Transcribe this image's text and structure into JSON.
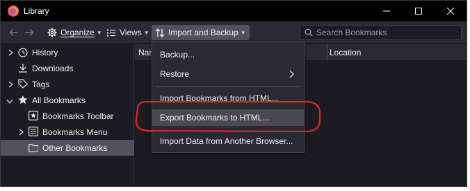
{
  "window": {
    "title": "Library"
  },
  "toolbar": {
    "organize_label": "Organize",
    "views_label": "Views",
    "import_label": "Import and Backup",
    "search_placeholder": "Search Bookmarks"
  },
  "sidebar": {
    "items": [
      {
        "label": "History",
        "icon": "clock-icon",
        "twisty": "collapsed"
      },
      {
        "label": "Downloads",
        "icon": "download-icon",
        "twisty": "none"
      },
      {
        "label": "Tags",
        "icon": "tag-icon",
        "twisty": "collapsed"
      },
      {
        "label": "All Bookmarks",
        "icon": "star-icon",
        "twisty": "expanded"
      },
      {
        "label": "Bookmarks Toolbar",
        "icon": "toolbar-folder-icon",
        "twisty": "none"
      },
      {
        "label": "Bookmarks Menu",
        "icon": "menu-folder-icon",
        "twisty": "collapsed"
      },
      {
        "label": "Other Bookmarks",
        "icon": "folder-icon",
        "twisty": "none",
        "selected": true
      }
    ]
  },
  "columns": {
    "name": "Nam",
    "location": "Location"
  },
  "menu": {
    "items": [
      {
        "label": "Backup...",
        "has_submenu": false
      },
      {
        "label": "Restore",
        "has_submenu": true
      },
      {
        "label": "Import Bookmarks from HTML...",
        "has_submenu": false
      },
      {
        "label": "Export Bookmarks to HTML...",
        "has_submenu": false,
        "highlighted": true
      },
      {
        "label": "Import Data from Another Browser...",
        "has_submenu": false
      }
    ]
  },
  "colors": {
    "annotation": "#e4202b",
    "window_bg": "#1c1b22",
    "menu_bg": "#2b2a33",
    "selected_bg": "#52525e"
  }
}
